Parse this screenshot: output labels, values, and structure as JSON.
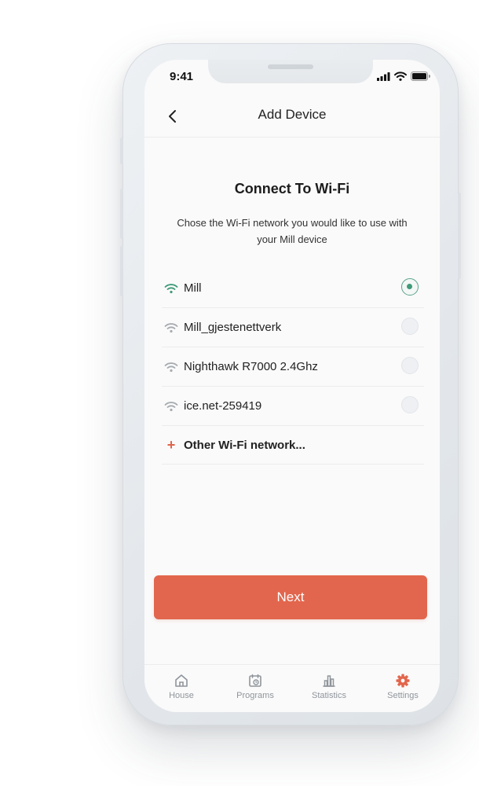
{
  "status_bar": {
    "time": "9:41"
  },
  "header": {
    "title": "Add Device"
  },
  "content": {
    "heading": "Connect To Wi-Fi",
    "subtext": "Chose the Wi-Fi network you would like   to use with your Mill device"
  },
  "networks": [
    {
      "name": "Mill",
      "selected": true
    },
    {
      "name": "Mill_gjestenettverk",
      "selected": false
    },
    {
      "name": "Nighthawk R7000 2.4Ghz",
      "selected": false
    },
    {
      "name": "ice.net-259419",
      "selected": false
    }
  ],
  "other_network": {
    "label": "Other Wi-Fi network..."
  },
  "next_button": {
    "label": "Next"
  },
  "tabs": [
    {
      "label": "House",
      "icon": "house-icon",
      "active": false
    },
    {
      "label": "Programs",
      "icon": "calendar-clock-icon",
      "active": false
    },
    {
      "label": "Statistics",
      "icon": "bar-chart-icon",
      "active": false
    },
    {
      "label": "Settings",
      "icon": "gear-icon",
      "active": true
    }
  ],
  "colors": {
    "accent": "#e2664d",
    "selected_wifi": "#3f9b78",
    "inactive_icon": "#8f959b"
  }
}
